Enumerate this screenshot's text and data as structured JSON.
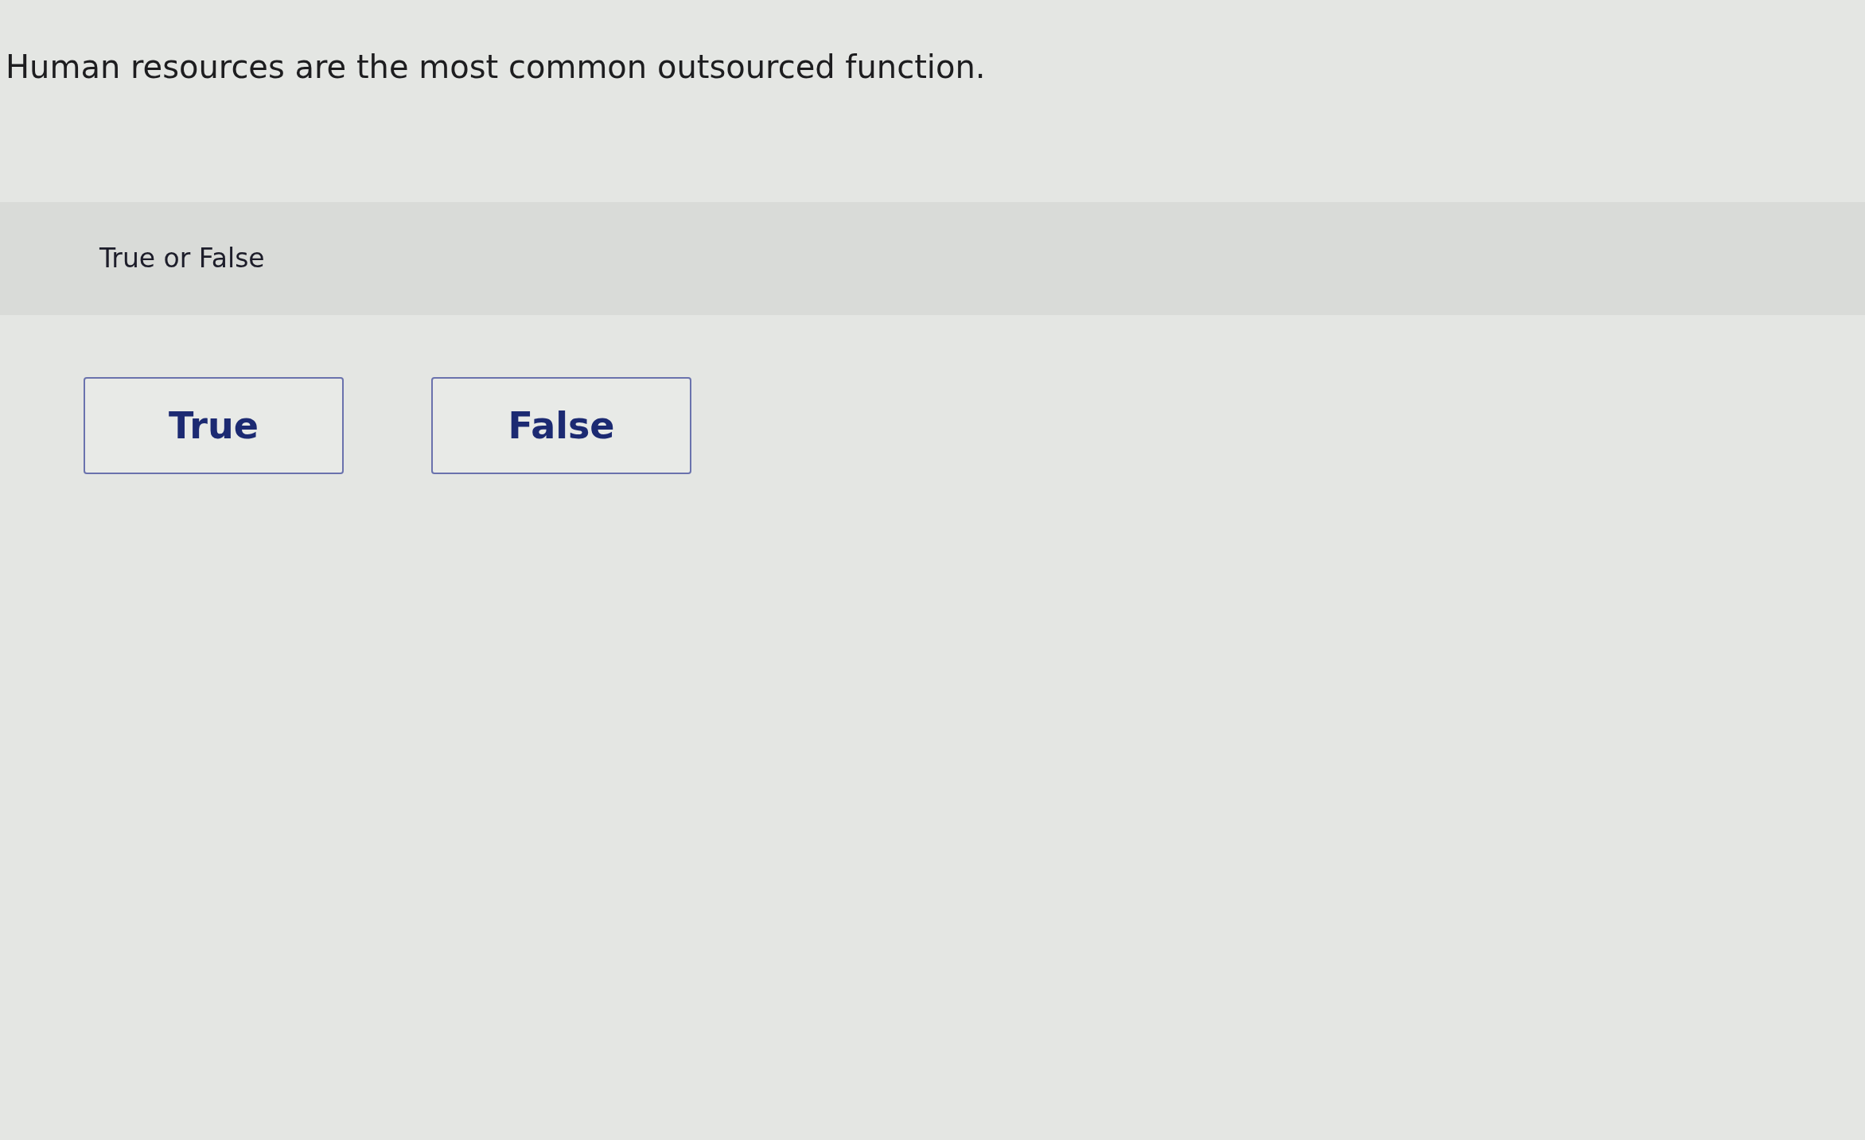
{
  "question": {
    "text": "Human resources are the most common outsourced function."
  },
  "prompt": {
    "label": "True or False"
  },
  "options": [
    {
      "label": "True",
      "selected": false
    },
    {
      "label": "False",
      "selected": false
    }
  ]
}
